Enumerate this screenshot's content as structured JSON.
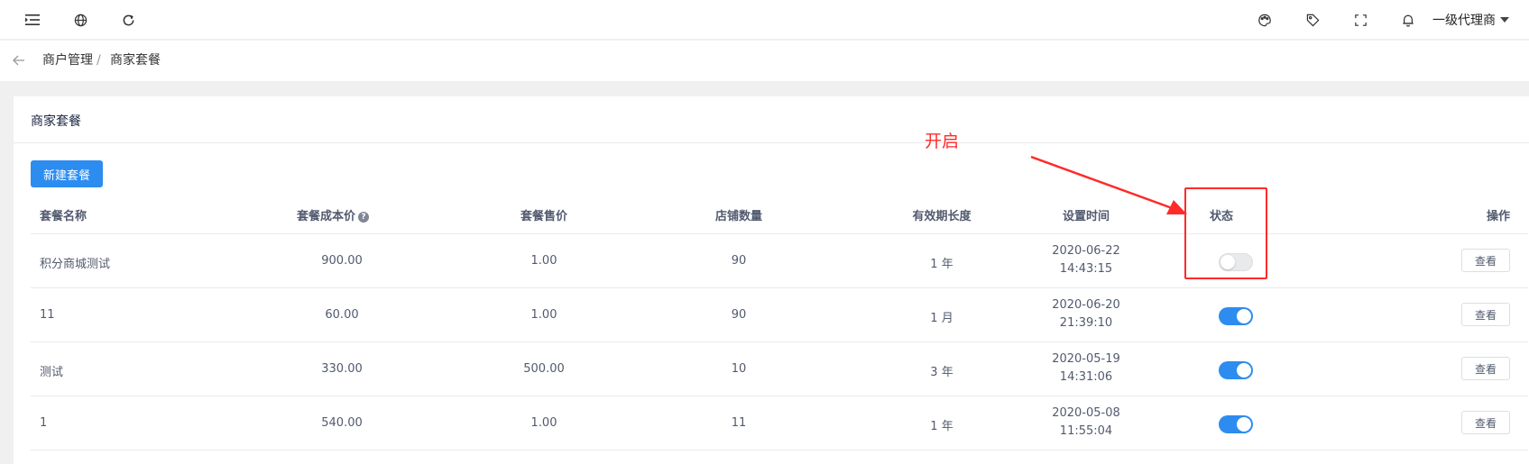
{
  "header": {
    "user_name": "一级代理商",
    "icons_left": [
      "menu-fold-icon",
      "globe-icon",
      "refresh-icon"
    ],
    "icons_right": [
      "palette-icon",
      "tag-icon",
      "fullscreen-icon",
      "bell-icon"
    ]
  },
  "breadcrumb": {
    "items": [
      "商户管理",
      "商家套餐"
    ],
    "separator": "/"
  },
  "card": {
    "title": "商家套餐",
    "new_button": "新建套餐"
  },
  "table": {
    "columns": {
      "name": "套餐名称",
      "cost": "套餐成本价",
      "price": "套餐售价",
      "stores": "店铺数量",
      "validity": "有效期长度",
      "time": "设置时间",
      "status": "状态",
      "action": "操作"
    },
    "rows": [
      {
        "name": "积分商城测试",
        "cost": "900.00",
        "price": "1.00",
        "stores": "90",
        "validity": "1 年",
        "date": "2020-06-22",
        "time": "14:43:15",
        "status": false,
        "action": "查看"
      },
      {
        "name": "11",
        "cost": "60.00",
        "price": "1.00",
        "stores": "90",
        "validity": "1 月",
        "date": "2020-06-20",
        "time": "21:39:10",
        "status": true,
        "action": "查看"
      },
      {
        "name": "测试",
        "cost": "330.00",
        "price": "500.00",
        "stores": "10",
        "validity": "3 年",
        "date": "2020-05-19",
        "time": "14:31:06",
        "status": true,
        "action": "查看"
      },
      {
        "name": "1",
        "cost": "540.00",
        "price": "1.00",
        "stores": "11",
        "validity": "1 年",
        "date": "2020-05-08",
        "time": "11:55:04",
        "status": true,
        "action": "查看"
      }
    ]
  },
  "annotation": {
    "label": "开启",
    "color": "#ff2a2a"
  },
  "colors": {
    "primary": "#2d8cf0",
    "switch_off": "#e8eaec"
  }
}
